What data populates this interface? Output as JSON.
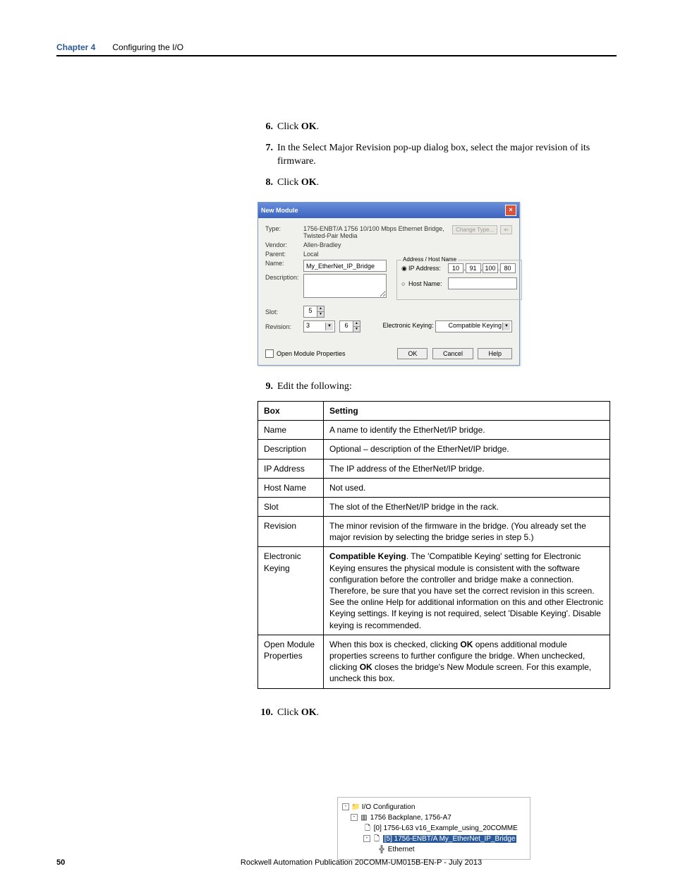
{
  "header": {
    "chapter_label": "Chapter 4",
    "chapter_title": "Configuring the I/O"
  },
  "steps": {
    "s6": {
      "num": "6.",
      "text_pre": "Click ",
      "bold": "OK",
      "text_post": "."
    },
    "s7": {
      "num": "7.",
      "text": "In the Select Major Revision pop-up dialog box, select the major revision of its firmware."
    },
    "s8": {
      "num": "8.",
      "text_pre": "Click ",
      "bold": "OK",
      "text_post": "."
    },
    "s9": {
      "num": "9.",
      "text": "Edit the following:"
    },
    "s10": {
      "num": "10.",
      "text_pre": "Click ",
      "bold": "OK",
      "text_post": "."
    }
  },
  "dialog": {
    "title": "New Module",
    "labels": {
      "type": "Type:",
      "vendor": "Vendor:",
      "parent": "Parent:",
      "name": "Name:",
      "description": "Description:",
      "slot": "Slot:",
      "revision": "Revision:",
      "addr_group": "Address / Host Name",
      "ip": "IP Address:",
      "host": "Host Name:",
      "ek": "Electronic Keying:",
      "open_props": "Open Module Properties",
      "change_type": "Change Type..."
    },
    "values": {
      "type": "1756-ENBT/A 1756 10/100 Mbps Ethernet Bridge, Twisted-Pair Media",
      "vendor": "Allen-Bradley",
      "parent": "Local",
      "name": "My_EtherNet_IP_Bridge",
      "slot": "5",
      "rev_major": "3",
      "rev_minor": "6",
      "ip": [
        "10",
        "91",
        "100",
        "80"
      ],
      "ek": "Compatible Keying"
    },
    "buttons": {
      "ok": "OK",
      "cancel": "Cancel",
      "help": "Help"
    }
  },
  "table": {
    "h1": "Box",
    "h2": "Setting",
    "rows": [
      {
        "box": "Name",
        "setting": "A name to identify the EtherNet/IP bridge."
      },
      {
        "box": "Description",
        "setting": "Optional – description of the EtherNet/IP bridge."
      },
      {
        "box": "IP Address",
        "setting": "The IP address of the EtherNet/IP bridge."
      },
      {
        "box": "Host Name",
        "setting": "Not used."
      },
      {
        "box": "Slot",
        "setting": "The slot of the EtherNet/IP bridge in the rack."
      },
      {
        "box": "Revision",
        "setting": "The minor revision of the firmware in the bridge. (You already set the major revision by selecting the bridge series in step 5.)"
      }
    ],
    "ek_row": {
      "box": "Electronic Keying",
      "bold": "Compatible Keying",
      "rest": ". The 'Compatible Keying' setting for Electronic Keying ensures the physical module is consistent with the software configuration before the controller and bridge make a connection. Therefore, be sure that you have set the correct revision in this screen. See the online Help for additional information on this and other Electronic Keying settings. If keying is not required, select 'Disable Keying'. Disable keying is recommended."
    },
    "omp_row": {
      "box": "Open Module Properties",
      "pre": "When this box is checked, clicking ",
      "b1": "OK",
      "mid": " opens additional module properties screens to further configure the bridge. When unchecked, clicking ",
      "b2": "OK",
      "post": " closes the bridge's New Module screen. For this example, uncheck this box."
    }
  },
  "tree": {
    "root": "I/O Configuration",
    "backplane": "1756 Backplane, 1756-A7",
    "slot0": "[0] 1756-L63 v16_Example_using_20COMME",
    "slot5": "[5] 1756-ENBT/A My_EtherNet_IP_Bridge",
    "eth": "Ethernet"
  },
  "footer": {
    "page": "50",
    "pub": "Rockwell Automation Publication 20COMM-UM015B-EN-P - July 2013"
  }
}
